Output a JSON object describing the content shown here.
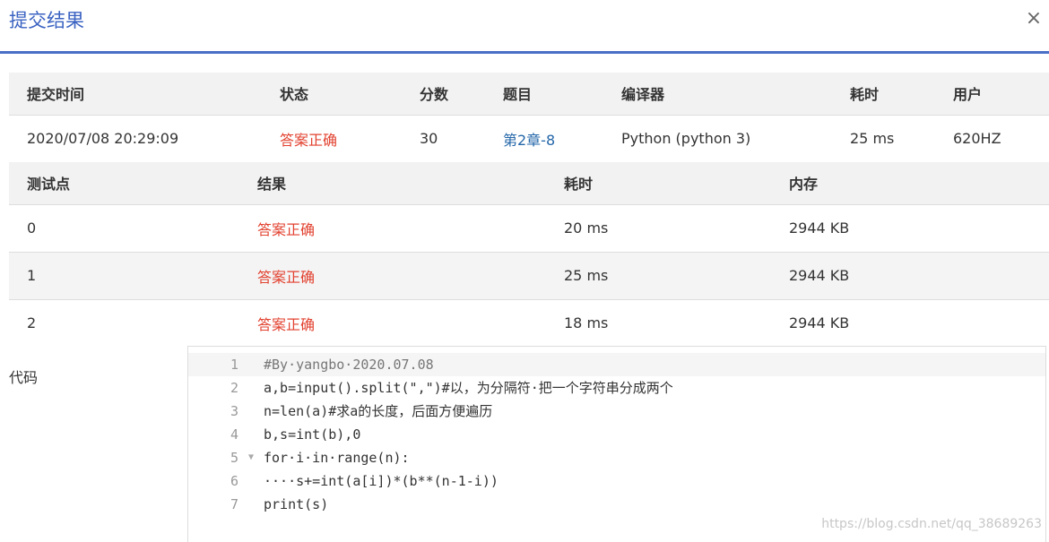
{
  "dialog": {
    "title": "提交结果",
    "close_icon": "close-icon",
    "close_glyph": "×"
  },
  "summary": {
    "headers": [
      "提交时间",
      "状态",
      "分数",
      "题目",
      "编译器",
      "耗时",
      "用户"
    ],
    "row": {
      "time": "2020/07/08 20:29:09",
      "status": "答案正确",
      "score": "30",
      "problem": "第2章-8",
      "compiler": "Python (python 3)",
      "elapsed": "25 ms",
      "user": "620HZ"
    }
  },
  "tests": {
    "headers": [
      "测试点",
      "结果",
      "耗时",
      "内存"
    ],
    "rows": [
      {
        "point": "0",
        "result": "答案正确",
        "time": "20 ms",
        "memory": "2944 KB"
      },
      {
        "point": "1",
        "result": "答案正确",
        "time": "25 ms",
        "memory": "2944 KB"
      },
      {
        "point": "2",
        "result": "答案正确",
        "time": "18 ms",
        "memory": "2944 KB"
      }
    ]
  },
  "code": {
    "label": "代码",
    "line_numbers": [
      "1",
      "2",
      "3",
      "4",
      "5",
      "6",
      "7"
    ],
    "lines": [
      "#By·yangbo·2020.07.08",
      "a,b=input().split(\",\")#以，为分隔符·把一个字符串分成两个",
      "n=len(a)#求a的长度，后面方便遍历",
      "b,s=int(b),0",
      "for·i·in·range(n):",
      "····s+=int(a[i])*(b**(n-1-i))",
      "print(s)"
    ]
  },
  "watermark": "https://blog.csdn.net/qq_38689263",
  "colors": {
    "accent": "#3b63c2",
    "success": "#e2412f",
    "link": "#2467a9"
  }
}
